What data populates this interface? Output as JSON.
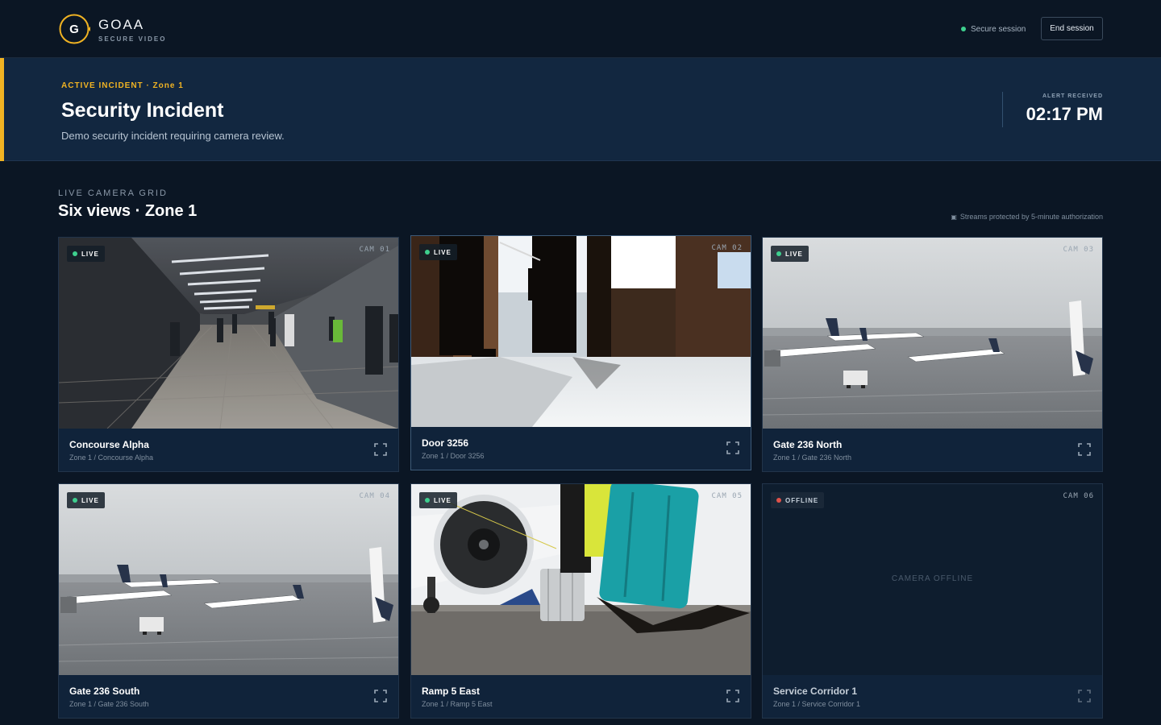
{
  "header": {
    "brand_letter": "G",
    "brand_name": "GOAA",
    "brand_sub": "SECURE VIDEO",
    "session_status": "Secure session",
    "end_session_label": "End session"
  },
  "incident": {
    "kicker": "ACTIVE INCIDENT · Zone 1",
    "title": "Security Incident",
    "description": "Demo security incident requiring camera review.",
    "alert_label": "ALERT RECEIVED",
    "alert_time": "02:17 PM"
  },
  "grid": {
    "kicker": "LIVE CAMERA GRID",
    "title": "Six views · Zone 1",
    "note": "Streams protected by 5-minute authorization",
    "offline_text": "CAMERA OFFLINE"
  },
  "cameras": [
    {
      "id": "CAM 01",
      "name": "Concourse Alpha",
      "path": "Zone 1 / Concourse Alpha",
      "status": "LIVE",
      "scene": "concourse"
    },
    {
      "id": "CAM 02",
      "name": "Door 3256",
      "path": "Zone 1 / Door 3256",
      "status": "LIVE",
      "scene": "door"
    },
    {
      "id": "CAM 03",
      "name": "Gate 236 North",
      "path": "Zone 1 / Gate 236 North",
      "status": "LIVE",
      "scene": "apron"
    },
    {
      "id": "CAM 04",
      "name": "Gate 236 South",
      "path": "Zone 1 / Gate 236 South",
      "status": "LIVE",
      "scene": "apron"
    },
    {
      "id": "CAM 05",
      "name": "Ramp 5 East",
      "path": "Zone 1 / Ramp 5 East",
      "status": "LIVE",
      "scene": "ramp"
    },
    {
      "id": "CAM 06",
      "name": "Service Corridor 1",
      "path": "Zone 1 / Service Corridor 1",
      "status": "OFFLINE",
      "scene": "none"
    }
  ],
  "colors": {
    "accent": "#f0b323",
    "live": "#3ecf8e",
    "offline": "#e0524a",
    "background": "#0b1624",
    "banner": "#122740"
  },
  "icons": {
    "logo": "goaa-logo-icon",
    "session": "status-dot-icon",
    "note": "lock-icon",
    "expand": "expand-icon"
  }
}
